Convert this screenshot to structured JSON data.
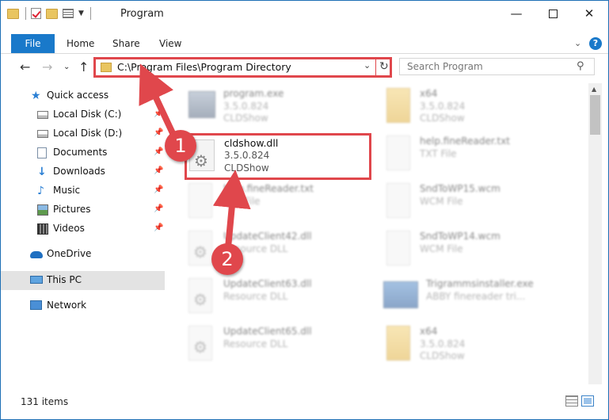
{
  "window": {
    "title": "Program"
  },
  "ribbon": {
    "tabs": [
      "File",
      "Home",
      "Share",
      "View"
    ]
  },
  "address": {
    "path": "C:\\Program Files\\Program Directory"
  },
  "search": {
    "placeholder": "Search Program"
  },
  "sidebar": {
    "items": [
      {
        "label": "Quick access",
        "icon": "star-icon"
      },
      {
        "label": "Local Disk (C:)",
        "icon": "disk-icon",
        "pinned": true
      },
      {
        "label": "Local Disk (D:)",
        "icon": "disk-icon",
        "pinned": true
      },
      {
        "label": "Documents",
        "icon": "documents-icon",
        "pinned": true
      },
      {
        "label": "Downloads",
        "icon": "downloads-icon",
        "pinned": true
      },
      {
        "label": "Music",
        "icon": "music-icon",
        "pinned": true
      },
      {
        "label": "Pictures",
        "icon": "pictures-icon",
        "pinned": true
      },
      {
        "label": "Videos",
        "icon": "videos-icon",
        "pinned": true
      },
      {
        "label": "OneDrive",
        "icon": "cloud-icon"
      },
      {
        "label": "This PC",
        "icon": "pc-icon",
        "selected": true
      },
      {
        "label": "Network",
        "icon": "network-icon"
      }
    ]
  },
  "files": [
    {
      "name": "program.exe",
      "sub1": "3.5.0.824",
      "sub2": "CLDShow",
      "icon": "exe-icon"
    },
    {
      "name": "x64",
      "sub1": "3.5.0.824",
      "sub2": "CLDShow",
      "icon": "folder-icon"
    },
    {
      "name": "help.fineReader.txt",
      "sub1": "TXT File",
      "sub2": "",
      "icon": "text-file-icon"
    },
    {
      "name": "help.fineReader.txt",
      "sub1": "TXT File",
      "sub2": "",
      "icon": "text-file-icon"
    },
    {
      "name": "SndToWP15.wcm",
      "sub1": "WCM File",
      "sub2": "",
      "icon": "file-icon"
    },
    {
      "name": "UpdateClient42.dll",
      "sub1": "Resource DLL",
      "sub2": "",
      "icon": "dll-icon"
    },
    {
      "name": "SndToWP14.wcm",
      "sub1": "WCM File",
      "sub2": "",
      "icon": "file-icon"
    },
    {
      "name": "UpdateClient63.dll",
      "sub1": "Resource DLL",
      "sub2": "",
      "icon": "dll-icon"
    },
    {
      "name": "Trigrammsinstaller.exe",
      "sub1": "ABBY finereader tri...",
      "sub2": "",
      "icon": "app-icon"
    },
    {
      "name": "UpdateClient65.dll",
      "sub1": "Resource DLL",
      "sub2": "",
      "icon": "dll-icon"
    },
    {
      "name": "x64",
      "sub1": "3.5.0.824",
      "sub2": "CLDShow",
      "icon": "folder-icon"
    }
  ],
  "highlighted_file": {
    "name": "cldshow.dll",
    "version": "3.5.0.824",
    "company": "CLDShow"
  },
  "annotations": {
    "step1": "1",
    "step2": "2",
    "color": "#e0474c"
  },
  "status": {
    "count": "131 items"
  }
}
